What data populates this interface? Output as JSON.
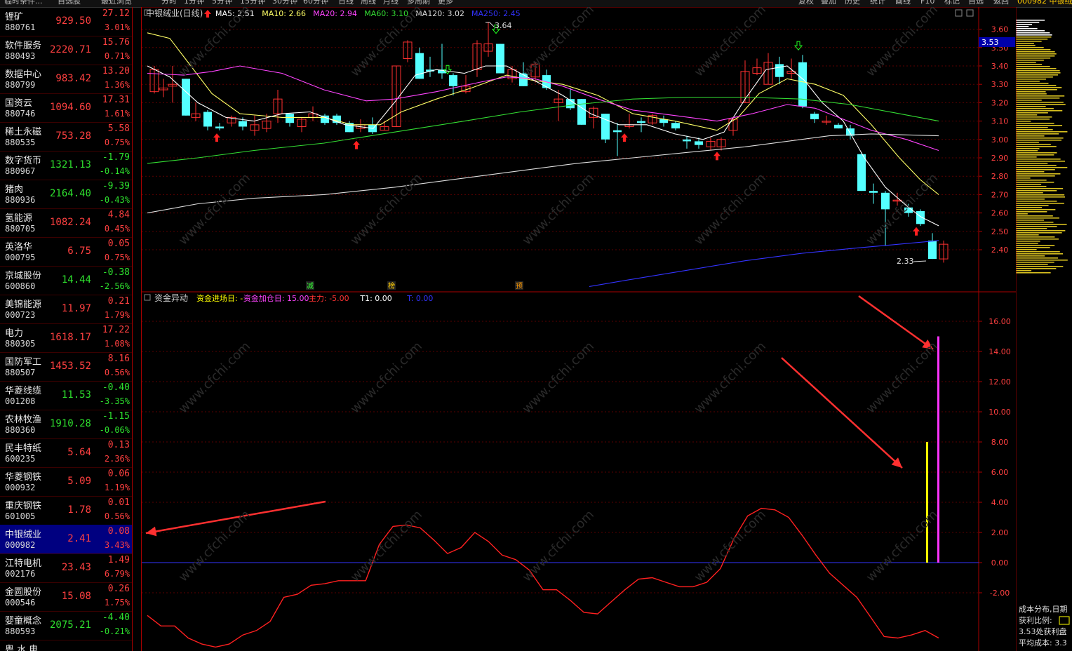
{
  "top_menu": [
    "分时",
    "1分钟",
    "5分钟",
    "15分钟",
    "30分钟",
    "60分钟",
    "日线",
    "周线",
    "月线",
    "多周期",
    "更多",
    "复权",
    "叠加",
    "历史",
    "统计",
    "画线",
    "F10",
    "标记",
    "自选",
    "返回"
  ],
  "top_left_label": "临时条件...",
  "top_tabs": [
    "自选股",
    "最近浏览"
  ],
  "top_right_label": "000982 中银绒",
  "sidebar": [
    {
      "name": "锂矿",
      "code": "880761",
      "price": "929.50",
      "chg": "27.12",
      "pct": "3.01%",
      "color": "red"
    },
    {
      "name": "软件服务",
      "code": "880493",
      "price": "2220.71",
      "chg": "15.76",
      "pct": "0.71%",
      "color": "red"
    },
    {
      "name": "数据中心",
      "code": "880799",
      "price": "983.42",
      "chg": "13.20",
      "pct": "1.36%",
      "color": "red"
    },
    {
      "name": "国资云",
      "code": "880746",
      "price": "1094.60",
      "chg": "17.31",
      "pct": "1.61%",
      "color": "red"
    },
    {
      "name": "稀土永磁",
      "code": "880535",
      "price": "753.28",
      "chg": "5.58",
      "pct": "0.75%",
      "color": "red"
    },
    {
      "name": "数字货币",
      "code": "880967",
      "price": "1321.13",
      "chg": "-1.79",
      "pct": "-0.14%",
      "color": "green"
    },
    {
      "name": "猪肉",
      "code": "880936",
      "price": "2164.40",
      "chg": "-9.39",
      "pct": "-0.43%",
      "color": "green"
    },
    {
      "name": "氢能源",
      "code": "880705",
      "price": "1082.24",
      "chg": "4.84",
      "pct": "0.45%",
      "color": "red"
    },
    {
      "name": "英洛华",
      "code": "000795",
      "price": "6.75",
      "chg": "0.05",
      "pct": "0.75%",
      "color": "red"
    },
    {
      "name": "京城股份",
      "code": "600860",
      "price": "14.44",
      "chg": "-0.38",
      "pct": "-2.56%",
      "color": "green"
    },
    {
      "name": "美锦能源",
      "code": "000723",
      "price": "11.97",
      "chg": "0.21",
      "pct": "1.79%",
      "color": "red"
    },
    {
      "name": "电力",
      "code": "880305",
      "price": "1618.17",
      "chg": "17.22",
      "pct": "1.08%",
      "color": "red"
    },
    {
      "name": "国防军工",
      "code": "880507",
      "price": "1453.52",
      "chg": "8.16",
      "pct": "0.56%",
      "color": "red"
    },
    {
      "name": "华菱线缆",
      "code": "001208",
      "price": "11.53",
      "chg": "-0.40",
      "pct": "-3.35%",
      "color": "green"
    },
    {
      "name": "农林牧渔",
      "code": "880360",
      "price": "1910.28",
      "chg": "-1.15",
      "pct": "-0.06%",
      "color": "green"
    },
    {
      "name": "民丰特纸",
      "code": "600235",
      "price": "5.64",
      "chg": "0.13",
      "pct": "2.36%",
      "color": "red"
    },
    {
      "name": "华菱钢铁",
      "code": "000932",
      "price": "5.09",
      "chg": "0.06",
      "pct": "1.19%",
      "color": "red"
    },
    {
      "name": "重庆钢铁",
      "code": "601005",
      "price": "1.78",
      "chg": "0.01",
      "pct": "0.56%",
      "color": "red"
    },
    {
      "name": "中银绒业",
      "code": "000982",
      "price": "2.41",
      "chg": "0.08",
      "pct": "3.43%",
      "color": "red",
      "selected": true
    },
    {
      "name": "江特电机",
      "code": "002176",
      "price": "23.43",
      "chg": "1.49",
      "pct": "6.79%",
      "color": "red"
    },
    {
      "name": "金圆股份",
      "code": "000546",
      "price": "15.08",
      "chg": "0.26",
      "pct": "1.75%",
      "color": "red"
    },
    {
      "name": "婴童概念",
      "code": "880593",
      "price": "2075.21",
      "chg": "-4.40",
      "pct": "-0.21%",
      "color": "green"
    },
    {
      "name": "粤 水 电",
      "code": "",
      "price": "",
      "chg": "",
      "pct": "",
      "color": "red"
    }
  ],
  "main_chart": {
    "title": "中银绒业(日线)",
    "ma_labels": [
      {
        "text": "MA5: 2.51",
        "color": "#ffffff"
      },
      {
        "text": "MA10: 2.66",
        "color": "#ffff66"
      },
      {
        "text": "MA20: 2.94",
        "color": "#ff44ff"
      },
      {
        "text": "MA60: 3.10",
        "color": "#33dd33"
      },
      {
        "text": "MA120: 3.02",
        "color": "#dddddd"
      },
      {
        "text": "MA250: 2.45",
        "color": "#3333ff"
      }
    ],
    "y_ticks": [
      "3.60",
      "3.50",
      "3.40",
      "3.30",
      "3.20",
      "3.10",
      "3.00",
      "2.90",
      "2.80",
      "2.70",
      "2.60",
      "2.50",
      "2.40"
    ],
    "current_price": "3.53",
    "high_label": "3.64",
    "low_label": "2.33",
    "markers": [
      "减",
      "榜",
      "预"
    ]
  },
  "indicator": {
    "title": "资金异动",
    "labels": [
      {
        "text": "资金进场日: -",
        "color": "#ffff00"
      },
      {
        "text": "资金加仓日: 15.00",
        "color": "#ff44ff"
      },
      {
        "text": "主力: -5.00",
        "color": "#ff3333"
      },
      {
        "text": "T1: 0.00",
        "color": "#ffffff"
      },
      {
        "text": "T: 0.00",
        "color": "#3333ff"
      }
    ],
    "y_ticks": [
      "16.00",
      "14.00",
      "12.00",
      "10.00",
      "8.00",
      "6.00",
      "4.00",
      "2.00",
      "0.00",
      "-2.00"
    ],
    "zhuli_values": [
      -3.5,
      -4.2,
      -4.2,
      -5.0,
      -5.4,
      -5.6,
      -5.4,
      -4.8,
      -4.5,
      -3.9,
      -2.3,
      -2.1,
      -1.5,
      -1.4,
      -1.2,
      -1.2,
      -1.2,
      1.2,
      2.4,
      2.5,
      2.3,
      1.5,
      0.6,
      1.0,
      2.0,
      1.4,
      0.5,
      0.2,
      -0.5,
      -1.8,
      -1.8,
      -2.5,
      -3.3,
      -3.4,
      -2.6,
      -1.8,
      -1.1,
      -1.0,
      -1.3,
      -1.6,
      -1.6,
      -1.3,
      -0.4,
      1.6,
      3.1,
      3.6,
      3.5,
      3.0,
      1.8,
      0.5,
      -0.7,
      -1.5,
      -2.3,
      -3.6,
      -4.9,
      -5.0,
      -4.8,
      -4.5,
      -5.0
    ],
    "bar_jinchang": 8.0,
    "bar_jiacang": 15.0
  },
  "right_panel": {
    "title": "成本分布,日期",
    "ratio_label": "获利比例:",
    "profit_label": "3.53处获利盘",
    "avg_cost": "平均成本: 3.3"
  },
  "watermark": "www.cfchi.com"
}
